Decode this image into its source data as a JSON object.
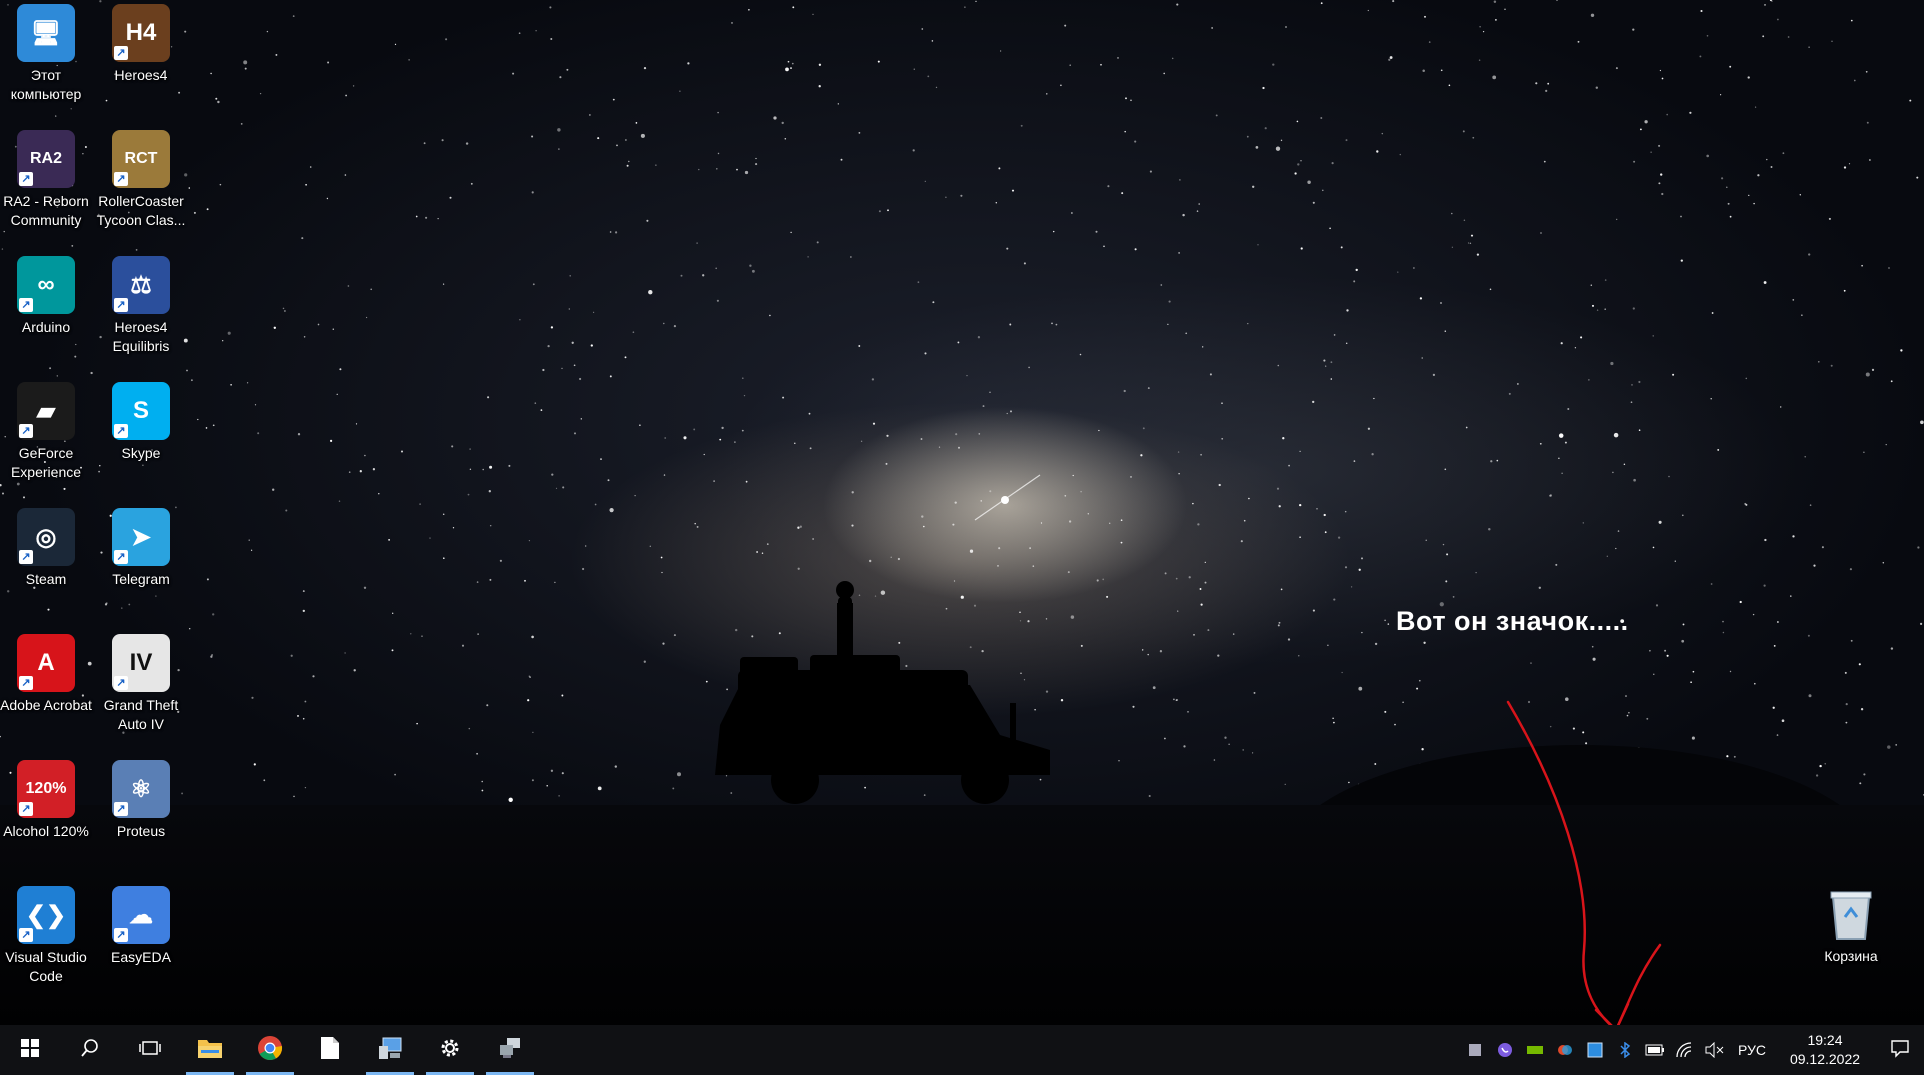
{
  "desktop": {
    "icons": [
      {
        "label": "Этот компьютер",
        "icon": "this-pc-icon"
      },
      {
        "label": "Heroes4",
        "icon": "heroes4-icon"
      },
      {
        "label": "RA2 - Reborn Community",
        "icon": "ra2-reborn-icon"
      },
      {
        "label": "RollerCoaster Tycoon Clas...",
        "icon": "rollercoaster-tycoon-icon"
      },
      {
        "label": "Arduino",
        "icon": "arduino-icon"
      },
      {
        "label": "Heroes4 Equilibris",
        "icon": "heroes4-equilibris-icon"
      },
      {
        "label": "GeForce Experience",
        "icon": "geforce-experience-icon"
      },
      {
        "label": "Skype",
        "icon": "skype-icon"
      },
      {
        "label": "Steam",
        "icon": "steam-icon"
      },
      {
        "label": "Telegram",
        "icon": "telegram-icon"
      },
      {
        "label": "Adobe Acrobat",
        "icon": "adobe-acrobat-icon"
      },
      {
        "label": "Grand Theft Auto IV",
        "icon": "gta-iv-icon"
      },
      {
        "label": "Alcohol 120%",
        "icon": "alcohol-120-icon"
      },
      {
        "label": "Proteus",
        "icon": "proteus-icon"
      },
      {
        "label": "Visual Studio Code",
        "icon": "vscode-icon"
      },
      {
        "label": "EasyEDA",
        "icon": "easyeda-icon"
      }
    ],
    "recycle_bin": {
      "label": "Корзина",
      "icon": "recycle-bin-icon"
    },
    "annotation": "Вот он значок.....",
    "annotation_color": "#d8141a"
  },
  "taskbar": {
    "background": "#101114",
    "accent": "#7cb7f2",
    "pinned": [
      {
        "name": "start",
        "icon": "windows-start-icon"
      },
      {
        "name": "search",
        "icon": "search-icon"
      },
      {
        "name": "task-view",
        "icon": "task-view-icon"
      },
      {
        "name": "file-explorer",
        "icon": "file-explorer-icon"
      },
      {
        "name": "chrome",
        "icon": "chrome-icon"
      },
      {
        "name": "notepad",
        "icon": "document-icon"
      },
      {
        "name": "device-manager",
        "icon": "device-manager-icon"
      },
      {
        "name": "settings",
        "icon": "gear-icon"
      },
      {
        "name": "network-app",
        "icon": "network-computer-icon"
      }
    ],
    "tray": {
      "icons": [
        "tray-app-icon",
        "viber-icon",
        "nvidia-icon",
        "tray-color-icon",
        "tray-window-icon",
        "bluetooth-icon",
        "battery-icon",
        "wifi-icon",
        "speaker-muted-icon"
      ],
      "language": "РУС",
      "time": "19:24",
      "date": "09.12.2022",
      "notifications_icon": "notifications-icon"
    }
  }
}
